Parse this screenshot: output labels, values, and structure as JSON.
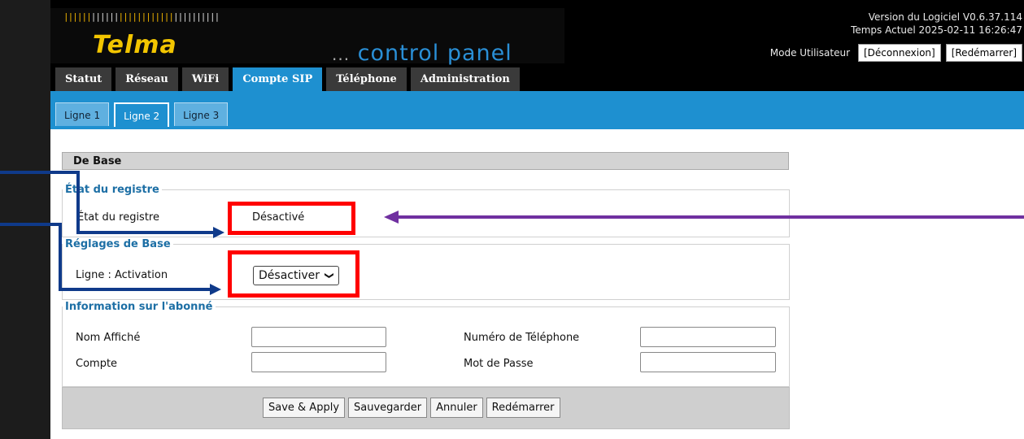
{
  "header": {
    "logo_bars": "||||||",
    "brand": "Telma",
    "control_panel_prefix": "...",
    "control_panel": "control panel",
    "version": "Version du Logiciel V0.6.37.114",
    "current_time": "Temps Actuel 2025-02-11 16:26:47",
    "mode_label": "Mode Utilisateur",
    "logout_button": "[Déconnexion]",
    "reboot_button": "[Redémarrer]"
  },
  "tabs": [
    "Statut",
    "Réseau",
    "WiFi",
    "Compte SIP",
    "Téléphone",
    "Administration"
  ],
  "active_tab": "Compte SIP",
  "subtabs": [
    "Ligne 1",
    "Ligne 2",
    "Ligne 3"
  ],
  "active_subtab": "Ligne 2",
  "section_title": "De Base",
  "register_status": {
    "legend": "État du registre",
    "label": "État du registre",
    "value": "Désactivé"
  },
  "basic_settings": {
    "legend": "Réglages de Base",
    "line_activation_label": "Ligne : Activation",
    "line_activation_value": "Désactiver",
    "line_activation_chevron": "❯"
  },
  "subscriber": {
    "legend": "Information sur l'abonné",
    "display_name_label": "Nom Affiché",
    "phone_number_label": "Numéro de Téléphone",
    "account_label": "Compte",
    "password_label": "Mot de Passe",
    "display_name_value": "",
    "phone_number_value": "",
    "account_value": "",
    "password_value": ""
  },
  "actions": {
    "save_apply": "Save & Apply",
    "save": "Sauvegarder",
    "cancel": "Annuler",
    "reboot": "Redémarrer"
  },
  "annotation_colors": {
    "highlight_box": "#ff0000",
    "left_arrows": "#0f3a8a",
    "right_arrow": "#7030a0"
  },
  "colors": {
    "accent_blue": "#1e90d0",
    "brand_yellow": "#f2c500",
    "legend_blue": "#1d6fa5"
  }
}
